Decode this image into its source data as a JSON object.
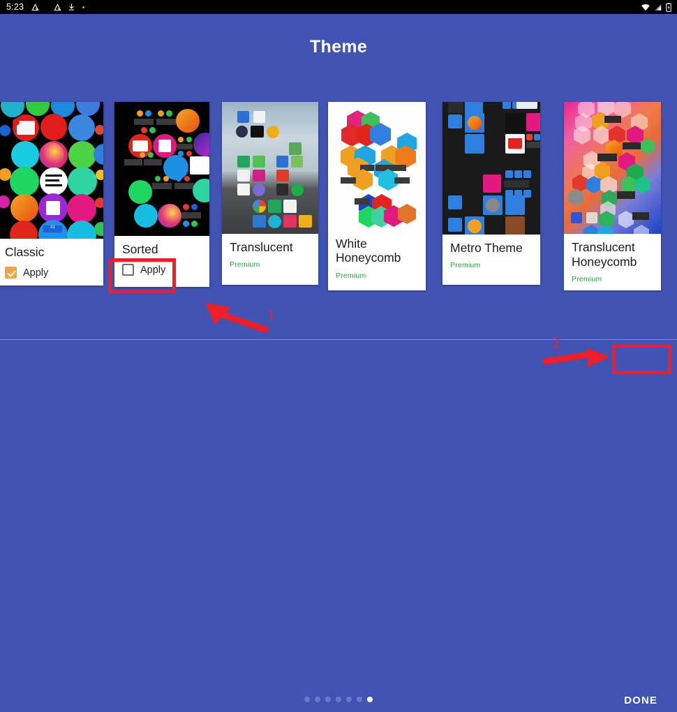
{
  "statusbar": {
    "time": "5:23",
    "left_icons": [
      "adaway-icon",
      "adaway-icon",
      "download-icon",
      "dot-icon"
    ],
    "right_icons": [
      "wifi-icon",
      "signal-icon",
      "battery-icon"
    ]
  },
  "header": {
    "title": "Theme"
  },
  "themes": [
    {
      "name": "Classic",
      "premium": "",
      "apply_label": "Apply",
      "checked": true
    },
    {
      "name": "Sorted",
      "premium": "",
      "apply_label": "Apply",
      "checked": false
    },
    {
      "name": "Translucent",
      "premium": "Premium",
      "apply_label": "",
      "checked": false
    },
    {
      "name": "White Honeycomb",
      "premium": "Premium",
      "apply_label": "",
      "checked": false
    },
    {
      "name": "Metro Theme",
      "premium": "Premium",
      "apply_label": "",
      "checked": false
    },
    {
      "name": "Translucent Honeycomb",
      "premium": "Premium",
      "apply_label": "",
      "checked": false
    }
  ],
  "footer": {
    "done_label": "DONE",
    "dots_total": 7,
    "dots_active_index": 6
  },
  "annotations": {
    "step1_number": "1",
    "step2_number": "2",
    "highlight_color": "#ef1d26"
  },
  "colors": {
    "background": "#4153b3",
    "accent_checkbox": "#f5a33c",
    "premium_text": "#2aa33f",
    "annotation_red": "#ef1d26"
  }
}
